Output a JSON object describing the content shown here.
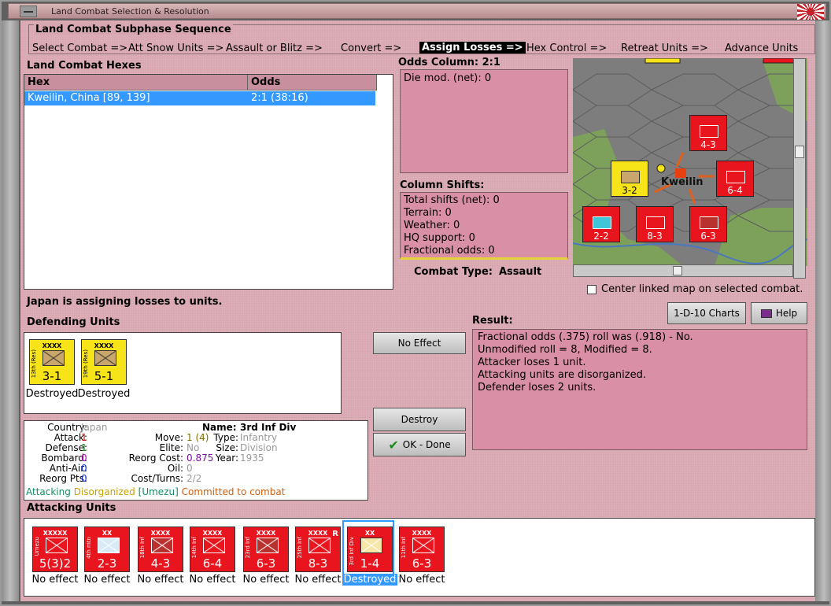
{
  "window": {
    "title": "Land Combat Selection & Resolution"
  },
  "subphase": {
    "title": "Land Combat Subphase Sequence",
    "steps": [
      {
        "label": "Select Combat =>",
        "active": false
      },
      {
        "label": "Att Snow Units =>",
        "active": false
      },
      {
        "label": "Assault or Blitz =>",
        "active": false
      },
      {
        "label": "Convert =>",
        "active": false
      },
      {
        "label": "Assign Losses =>",
        "active": true
      },
      {
        "label": "Hex Control =>",
        "active": false
      },
      {
        "label": "Retreat Units =>",
        "active": false
      },
      {
        "label": "Advance Units",
        "active": false
      }
    ]
  },
  "hexes": {
    "title": "Land Combat Hexes",
    "columns": [
      "Hex",
      "Odds"
    ],
    "rows": [
      {
        "hex": "Kweilin, China [89, 139]",
        "odds": "2:1 (38:16)"
      }
    ]
  },
  "odds": {
    "title": "Odds Column: 2:1",
    "die_mod": "Die mod. (net): 0"
  },
  "shifts": {
    "title": "Column Shifts:",
    "lines": [
      "Total shifts (net): 0",
      "Terrain: 0",
      "Weather: 0",
      "HQ support: 0",
      "Fractional odds: 0"
    ]
  },
  "combat_type": {
    "label": "Combat Type:",
    "value": "Assault"
  },
  "map": {
    "city": "Kweilin",
    "center_checkbox": "Center linked map on selected combat.",
    "counters": [
      {
        "str": "4-3",
        "color": "red"
      },
      {
        "str": "3-2",
        "color": "yellow"
      },
      {
        "str": "6-4",
        "color": "red"
      },
      {
        "str": "2-2",
        "color": "red"
      },
      {
        "str": "8-3",
        "color": "red"
      },
      {
        "str": "6-3",
        "color": "red"
      }
    ]
  },
  "status_message": "Japan is assigning losses to units.",
  "buttons": {
    "charts": "1-D-10 Charts",
    "help": "Help",
    "no_effect": "No Effect",
    "destroy": "Destroy",
    "ok_done": "OK - Done"
  },
  "defending": {
    "title": "Defending Units",
    "units": [
      {
        "side": "13th (Res)",
        "size": "XXXX",
        "str": "3-1",
        "status": "Destroyed"
      },
      {
        "side": "19th (Res)",
        "size": "XXXX",
        "str": "5-1",
        "status": "Destroyed"
      }
    ]
  },
  "result": {
    "title": "Result:",
    "lines": [
      "Fractional odds (.375) roll was (.918)  - No.",
      "Unmodified roll = 8, Modified = 8.",
      "Attacker loses 1 unit.",
      "Attacking units are disorganized.",
      "Defender loses 2 units."
    ]
  },
  "unit_info": {
    "country_label": "Country:",
    "country": "Japan",
    "attack_label": "Attack:",
    "attack": "1",
    "defense_label": "Defense:",
    "defense": "1",
    "bombard_label": "Bombard:",
    "bombard": "0",
    "antiair_label": "Anti-Air:",
    "antiair": "0",
    "reorg_label": "Reorg Pts:",
    "reorg": "0",
    "name_label": "Name:",
    "name": "3rd Inf Div",
    "move_label": "Move:",
    "move": "1 (4)",
    "elite_label": "Elite:",
    "elite": "No",
    "reorgcost_label": "Reorg Cost:",
    "reorgcost": "0.875",
    "oil_label": "Oil:",
    "oil": "0",
    "costturns_label": "Cost/Turns:",
    "costturns": "2/2",
    "type_label": "Type:",
    "type": "Infantry",
    "size_label": "Size:",
    "size": "Division",
    "year_label": "Year:",
    "year": "1935",
    "status_attacking": "Attacking",
    "status_disorganized": "Disorganized",
    "status_hq": "[Umezu]",
    "status_committed": "Committed to combat"
  },
  "attacking": {
    "title": "Attacking Units",
    "units": [
      {
        "side": "Umezu",
        "size": "XXXXX",
        "str": "5(3)2",
        "status": "No effect",
        "selected": false
      },
      {
        "side": "4th mtn",
        "size": "XX",
        "str": "2-3",
        "status": "No effect",
        "selected": false
      },
      {
        "side": "18th Inf",
        "size": "XXXX",
        "str": "4-3",
        "status": "No effect",
        "selected": false
      },
      {
        "side": "14th Inf",
        "size": "XXXX",
        "str": "6-4",
        "status": "No effect",
        "selected": false
      },
      {
        "side": "23rd Inf",
        "size": "XXXX",
        "str": "6-3",
        "status": "No effect",
        "selected": false
      },
      {
        "side": "25th Inf",
        "size": "XXXX",
        "str": "8-3",
        "status": "No effect",
        "selected": false
      },
      {
        "side": "3rd Inf Div",
        "size": "XX",
        "str": "1-4",
        "status": "Destroyed",
        "selected": true
      },
      {
        "side": "11th Inf",
        "size": "XXXX",
        "str": "6-3",
        "status": "No effect",
        "selected": false
      }
    ]
  },
  "colors": {
    "background": "#d9a7b1",
    "panel_pink": "#d98fa6",
    "selection": "#3399ff",
    "unit_red": "#e8141e",
    "unit_yellow": "#f7e418"
  }
}
